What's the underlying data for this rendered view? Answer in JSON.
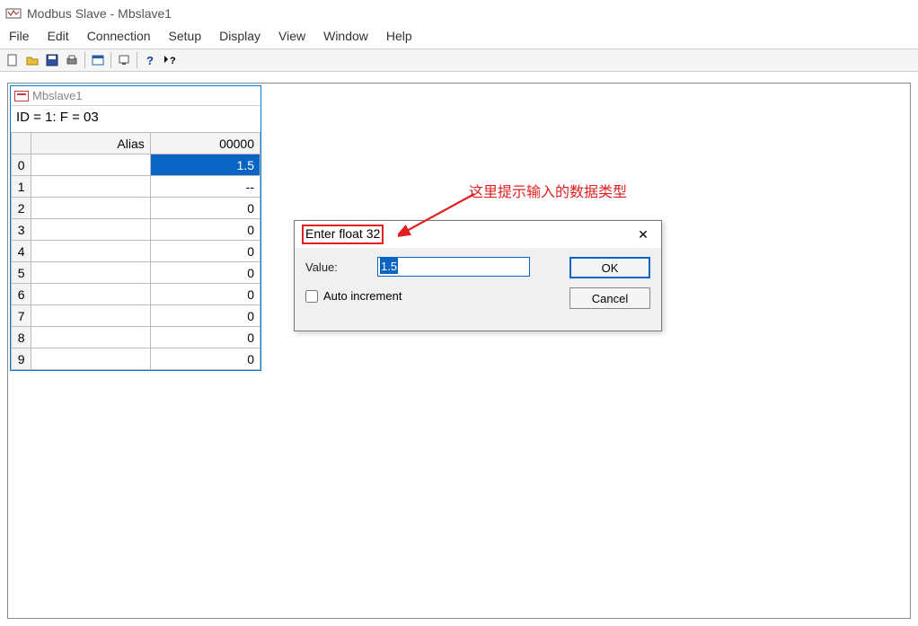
{
  "window": {
    "title": "Modbus Slave - Mbslave1"
  },
  "menu": {
    "items": [
      "File",
      "Edit",
      "Connection",
      "Setup",
      "Display",
      "View",
      "Window",
      "Help"
    ]
  },
  "toolbar": {
    "buttons": [
      "new",
      "open",
      "save",
      "print",
      "|",
      "window",
      "|",
      "conn",
      "|",
      "help",
      "whats-this"
    ]
  },
  "child": {
    "title": "Mbslave1",
    "status": "ID = 1: F = 03"
  },
  "table": {
    "headers": [
      "",
      "Alias",
      "00000"
    ],
    "rows": [
      {
        "n": "0",
        "alias": "",
        "val": "1.5",
        "selected": true
      },
      {
        "n": "1",
        "alias": "",
        "val": "--"
      },
      {
        "n": "2",
        "alias": "",
        "val": "0"
      },
      {
        "n": "3",
        "alias": "",
        "val": "0"
      },
      {
        "n": "4",
        "alias": "",
        "val": "0"
      },
      {
        "n": "5",
        "alias": "",
        "val": "0"
      },
      {
        "n": "6",
        "alias": "",
        "val": "0"
      },
      {
        "n": "7",
        "alias": "",
        "val": "0"
      },
      {
        "n": "8",
        "alias": "",
        "val": "0"
      },
      {
        "n": "9",
        "alias": "",
        "val": "0"
      }
    ]
  },
  "dialog": {
    "title": "Enter float 32",
    "value_label": "Value:",
    "value": "1.5",
    "auto_increment_label": "Auto increment",
    "ok": "OK",
    "cancel": "Cancel"
  },
  "annotation": {
    "text": "这里提示输入的数据类型"
  }
}
